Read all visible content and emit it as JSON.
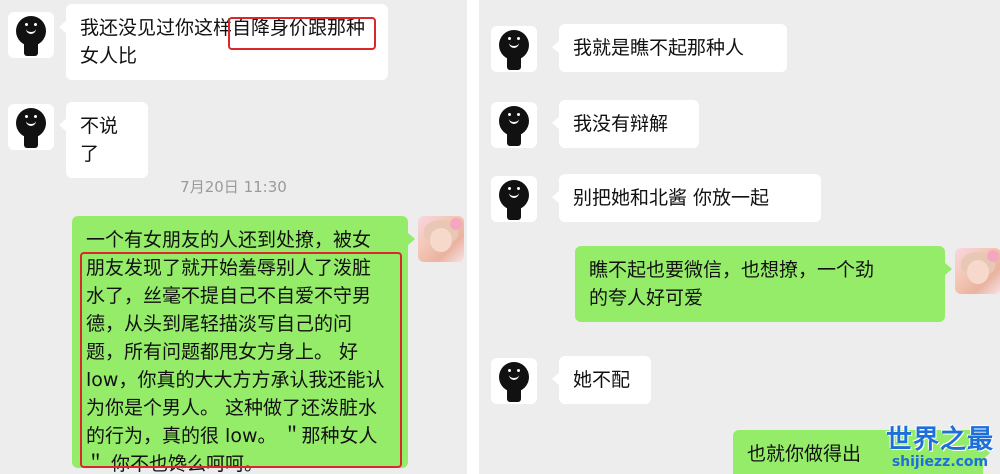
{
  "left_panel": {
    "messages": [
      {
        "text_line1": "我还没见过你这样自降身价跟那种",
        "text_line2": "女人比"
      },
      {
        "text": "不说了"
      }
    ],
    "timestamp": "7月20日 11:30",
    "long_message": {
      "lines": [
        "一个有女朋友的人还到处撩，被女",
        "朋友发现了就开始羞辱别人了泼脏",
        "水了，丝毫不提自己不自爱不守男",
        "德，从头到尾轻描淡写自己的问",
        "题，所有问题都甩女方身上。 好",
        "low，你真的大大方方承认我还能认",
        "为你是个男人。 这种做了还泼脏水",
        "的行为，真的很 low。 ＂那种女人",
        "＂ 你不也馋么呵呵。"
      ]
    }
  },
  "right_panel": {
    "messages": [
      {
        "text": "我就是瞧不起那种人"
      },
      {
        "text": "我没有辩解"
      },
      {
        "text": "别把她和北酱 你放一起"
      },
      {
        "line1": "瞧不起也要微信，也想撩，一个劲",
        "line2": "的夸人好可爱"
      },
      {
        "text": "她不配"
      },
      {
        "text": "也就你做得出"
      }
    ]
  },
  "watermark": {
    "main": "世界之最",
    "sub": "shijiezz.com"
  },
  "colors": {
    "bubble_green": "#95ec69",
    "bubble_white": "#ffffff",
    "background": "#ededed",
    "highlight_red": "#d8282b",
    "watermark_blue": "#1e6fd9"
  }
}
